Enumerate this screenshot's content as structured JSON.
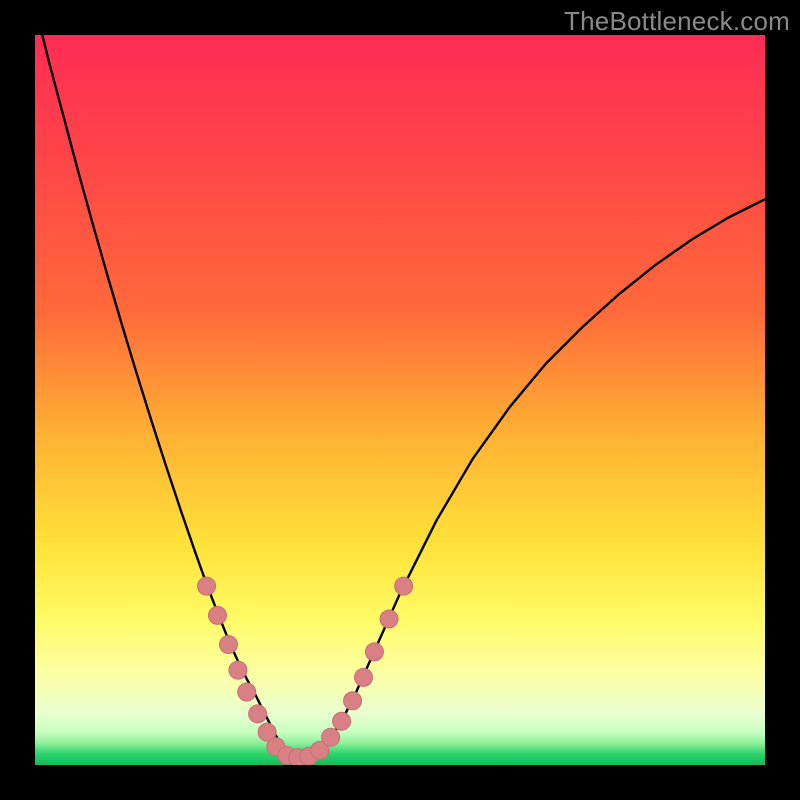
{
  "watermark": "TheBottleneck.com",
  "colors": {
    "black": "#000000",
    "curve": "#000000",
    "marker_fill": "#d98085",
    "marker_stroke": "#c86d73",
    "gradient_top": "#ff2c55",
    "gradient_mid1": "#ff6a3a",
    "gradient_mid2": "#ffb233",
    "gradient_mid3": "#ffe23a",
    "gradient_mid4": "#fffb66",
    "gradient_mid5": "#fcffa8",
    "gradient_bottom_pale": "#e8ffd0",
    "gradient_green": "#2bd36b"
  },
  "chart_data": {
    "type": "line",
    "title": "",
    "xlabel": "",
    "ylabel": "",
    "xlim": [
      0,
      100
    ],
    "ylim": [
      0,
      100
    ],
    "series": [
      {
        "name": "bottleneck-curve",
        "x": [
          0,
          2,
          4,
          6,
          8,
          10,
          12,
          14,
          16,
          18,
          20,
          21,
          22,
          23,
          24,
          25,
          26,
          27,
          28,
          29,
          30,
          31,
          32,
          33,
          34,
          35,
          36,
          37,
          38,
          40,
          42,
          44,
          46,
          48,
          50,
          55,
          60,
          65,
          70,
          75,
          80,
          85,
          90,
          95,
          100
        ],
        "y": [
          104,
          96,
          88.5,
          81,
          73.8,
          66.8,
          60,
          53.4,
          47,
          40.8,
          34.8,
          31.9,
          29,
          26.2,
          23.5,
          20.9,
          18.4,
          16,
          13.8,
          11.8,
          10,
          8,
          6,
          4,
          2.5,
          1.5,
          1,
          1,
          1.5,
          3,
          6,
          10,
          14.5,
          19,
          23.5,
          33.5,
          42,
          49,
          55,
          60,
          64.5,
          68.5,
          72,
          75,
          77.5
        ]
      }
    ],
    "markers": [
      {
        "x": 23.5,
        "y": 24.5
      },
      {
        "x": 25.0,
        "y": 20.5
      },
      {
        "x": 26.5,
        "y": 16.5
      },
      {
        "x": 27.8,
        "y": 13.0
      },
      {
        "x": 29.0,
        "y": 10.0
      },
      {
        "x": 30.5,
        "y": 7.0
      },
      {
        "x": 31.8,
        "y": 4.5
      },
      {
        "x": 33.0,
        "y": 2.5
      },
      {
        "x": 34.5,
        "y": 1.3
      },
      {
        "x": 36.0,
        "y": 1.0
      },
      {
        "x": 37.5,
        "y": 1.2
      },
      {
        "x": 39.0,
        "y": 2.0
      },
      {
        "x": 40.5,
        "y": 3.8
      },
      {
        "x": 42.0,
        "y": 6.0
      },
      {
        "x": 43.5,
        "y": 8.8
      },
      {
        "x": 45.0,
        "y": 12.0
      },
      {
        "x": 46.5,
        "y": 15.5
      },
      {
        "x": 48.5,
        "y": 20.0
      },
      {
        "x": 50.5,
        "y": 24.5
      }
    ],
    "marker_radius": 9
  }
}
